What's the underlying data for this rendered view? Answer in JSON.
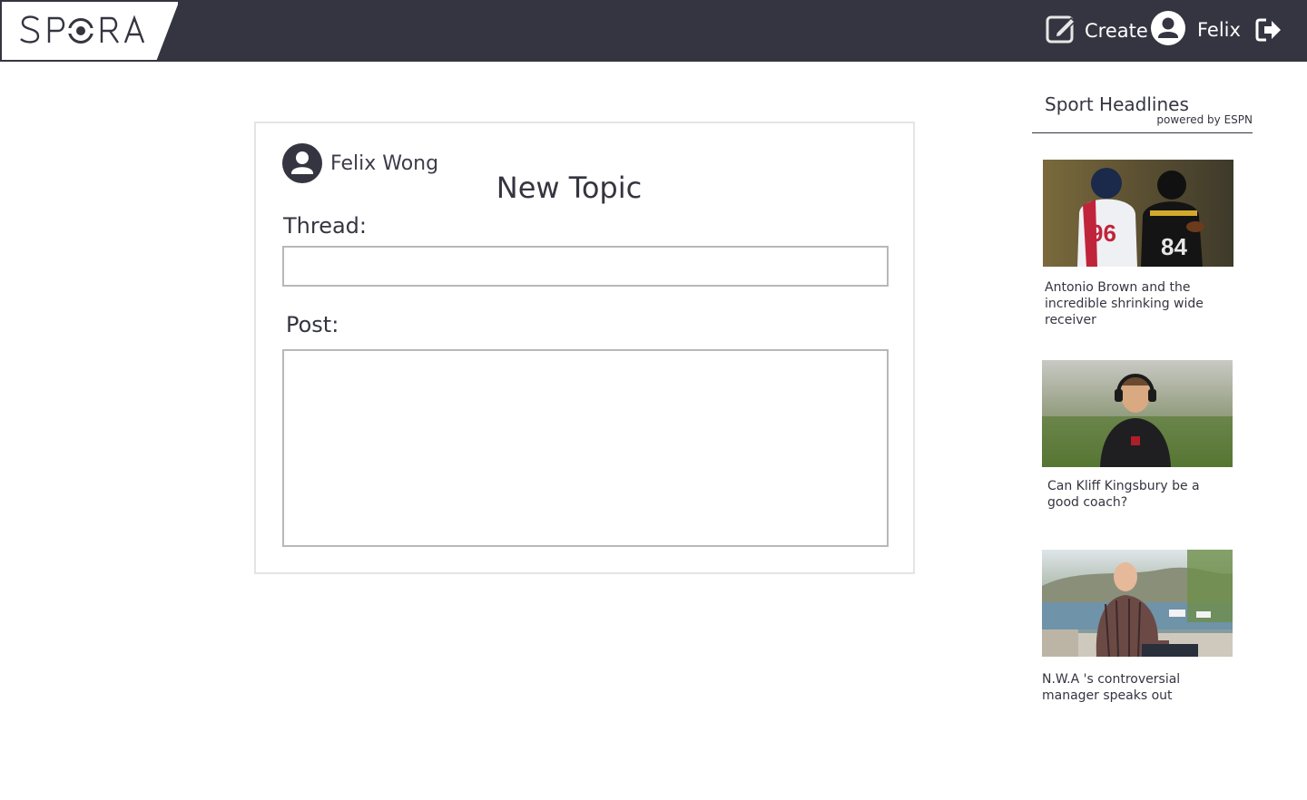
{
  "header": {
    "logo_text": "SPORA",
    "create_label": "Create",
    "user_label": "Felix",
    "colors": {
      "bar": "#353541",
      "text": "#ffffff"
    },
    "icons": [
      "edit-icon",
      "user-avatar-icon",
      "logout-icon"
    ]
  },
  "form": {
    "author_name": "Felix Wong",
    "title": "New Topic",
    "thread_label": "Thread:",
    "thread_value": "",
    "post_label": "Post:",
    "post_value": ""
  },
  "sidebar": {
    "title": "Sport Headlines",
    "powered_by": "powered by ESPN",
    "items": [
      {
        "caption": "Antonio Brown and the incredible shrinking wide receiver",
        "image": "football-players-photo"
      },
      {
        "caption": "Can Kliff Kingsbury be a good coach?",
        "image": "coach-headset-photo"
      },
      {
        "caption": "N.W.A 's controversial manager speaks out",
        "image": "elderly-man-lake-photo"
      }
    ]
  }
}
